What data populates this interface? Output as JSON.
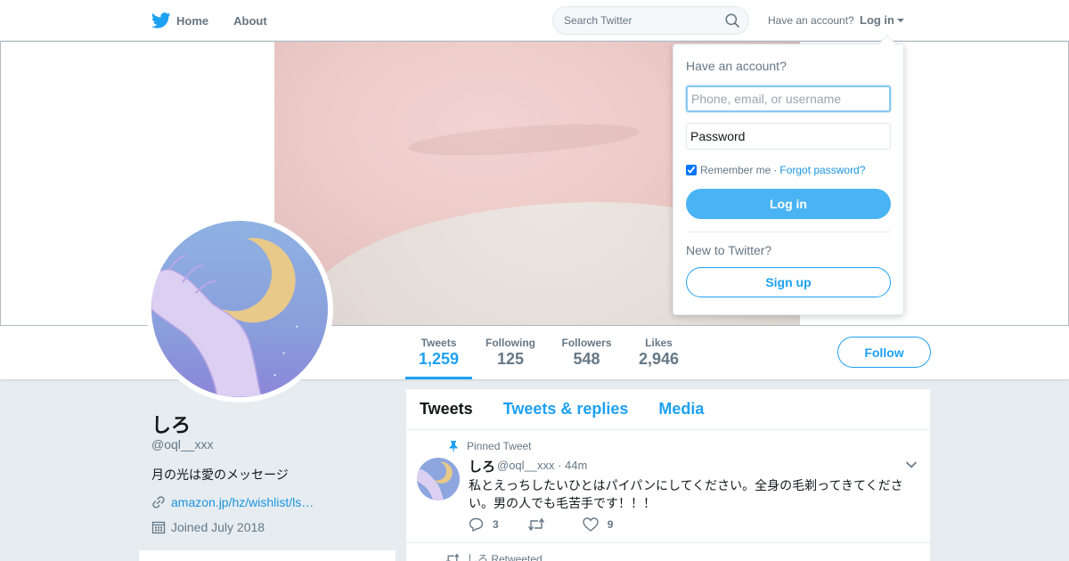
{
  "nav": {
    "home_label": "Home",
    "about_label": "About",
    "search_placeholder": "Search Twitter",
    "account_prompt": "Have an account?",
    "login_label": "Log in"
  },
  "profile": {
    "name": "しろ",
    "handle": "@oql__xxx",
    "bio": "月の光は愛のメッセージ",
    "url": "amazon.jp/hz/wishlist/ls…",
    "joined": "Joined July 2018",
    "stats": [
      {
        "label": "Tweets",
        "value": "1,259"
      },
      {
        "label": "Following",
        "value": "125"
      },
      {
        "label": "Followers",
        "value": "548"
      },
      {
        "label": "Likes",
        "value": "2,946"
      }
    ],
    "follow_label": "Follow"
  },
  "timeline": {
    "tabs": [
      "Tweets",
      "Tweets & replies",
      "Media"
    ],
    "pinned_label": "Pinned Tweet",
    "tweet": {
      "name": "しろ",
      "meta": "@oql__xxx · 44m",
      "text": "私とえっちしたいひとはパイパンにしてください。全身の毛剃ってきてください。男の人でも毛苦手です！！！",
      "replies": "3",
      "retweets": "",
      "likes": "9"
    },
    "retweeted_label": "しろ Retweeted"
  },
  "login_dropdown": {
    "title": "Have an account?",
    "username_placeholder": "Phone, email, or username",
    "password_placeholder": "Password",
    "remember_label": "Remember me",
    "separator": "·",
    "forgot_label": "Forgot password?",
    "login_button": "Log in",
    "new_prompt": "New to Twitter?",
    "signup_button": "Sign up"
  },
  "colors": {
    "accent": "#1da1f2",
    "login_button_bg": "#4ab3f4",
    "page_bg": "#e6ecf0"
  }
}
